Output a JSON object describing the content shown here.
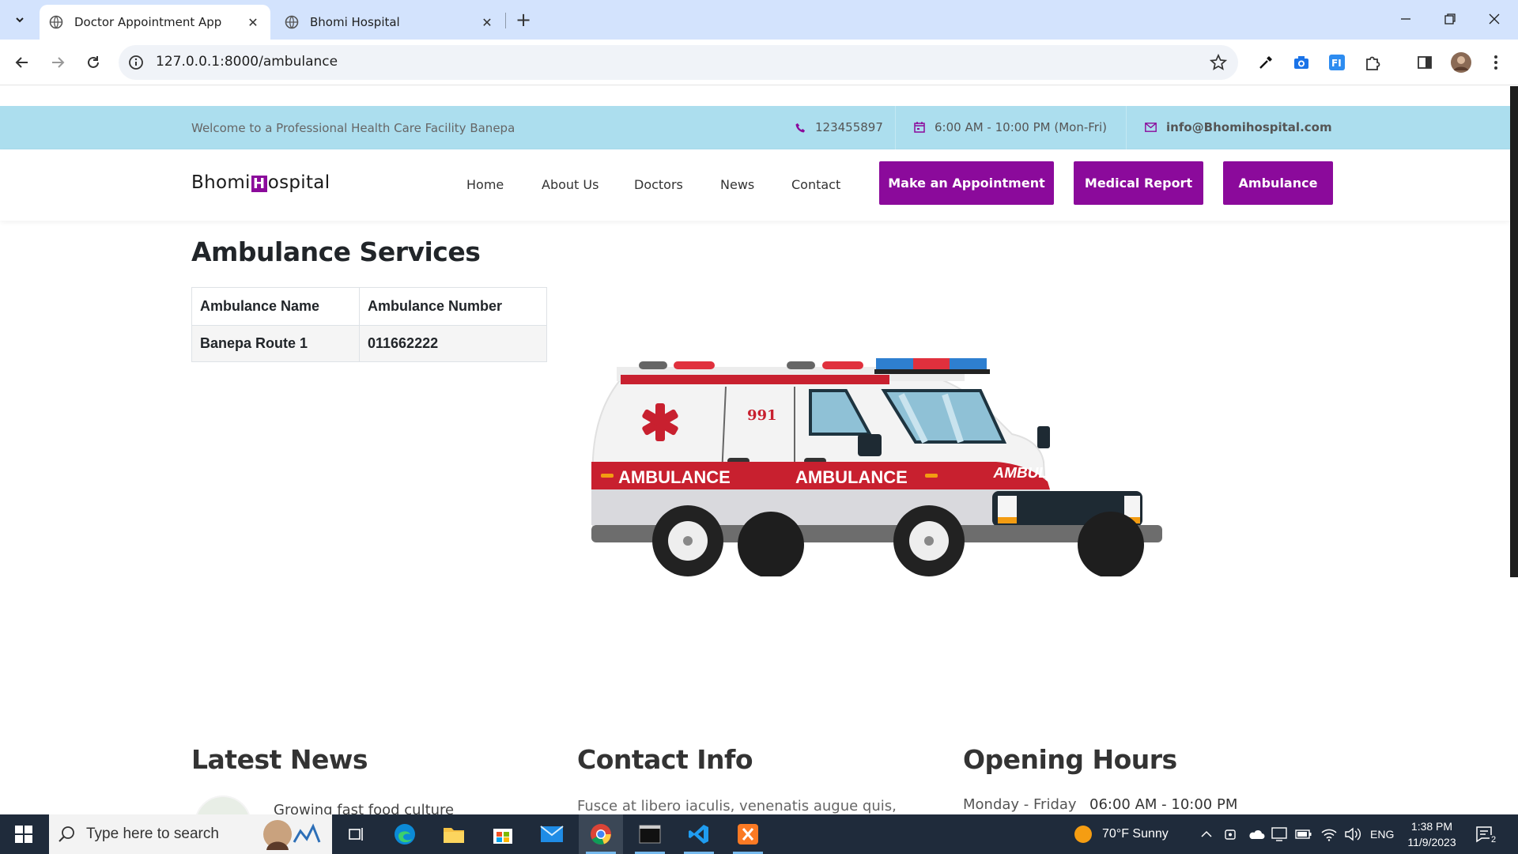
{
  "browser": {
    "tabs": [
      {
        "title": "Doctor Appointment App",
        "active": true
      },
      {
        "title": "Bhomi Hospital",
        "active": false
      }
    ],
    "url": "127.0.0.1:8000/ambulance"
  },
  "topbar": {
    "welcome": "Welcome to a Professional Health Care Facility Banepa",
    "phone": "123455897",
    "hours": "6:00 AM - 10:00 PM (Mon-Fri)",
    "email": "info@Bhomihospital.com"
  },
  "header": {
    "logo_left": "Bhomi",
    "logo_mark": "H",
    "logo_right": "ospital",
    "nav": [
      "Home",
      "About Us",
      "Doctors",
      "News",
      "Contact"
    ],
    "buttons": [
      "Make an Appointment",
      "Medical Report",
      "Ambulance"
    ]
  },
  "ambulance": {
    "title": "Ambulance Services",
    "columns": [
      "Ambulance Name",
      "Ambulance Number"
    ],
    "rows": [
      [
        "Banepa Route 1",
        "011662222"
      ]
    ],
    "illustration": {
      "side_label": "AMBULANCE",
      "front_label": "AMBULANCE",
      "number": "991",
      "body_color": "#f2f2f2",
      "stripe_color": "#c8202f"
    }
  },
  "footer": {
    "news_title": "Latest News",
    "news_item": "Growing fast food culture",
    "contact_title": "Contact Info",
    "contact_text": "Fusce at libero iaculis, venenatis augue quis,",
    "hours_title": "Opening Hours",
    "hours_day": "Monday - Friday",
    "hours_time": "06:00 AM - 10:00 PM"
  },
  "accent_color": "#8b0a9b",
  "taskbar": {
    "search_placeholder": "Type here to search",
    "weather": "70°F  Sunny",
    "language": "ENG",
    "time": "1:38 PM",
    "date": "11/9/2023",
    "notifications": "2"
  }
}
